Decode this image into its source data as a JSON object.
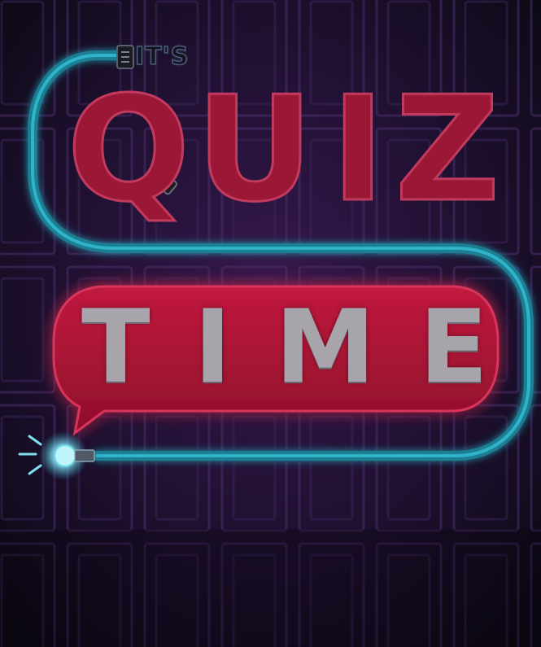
{
  "title": {
    "prefix": "IT'S",
    "line1": [
      "Q",
      "U",
      "I",
      "Z"
    ],
    "line2": "TIME"
  },
  "colors": {
    "background": "#0f0a18",
    "neon_red": "#c21e48",
    "neon_blue": "#2fb3c9",
    "letter_gray": "#a7a4ac"
  },
  "icons": [
    "plug-icon",
    "lightbulb-icon",
    "speech-bubble"
  ]
}
